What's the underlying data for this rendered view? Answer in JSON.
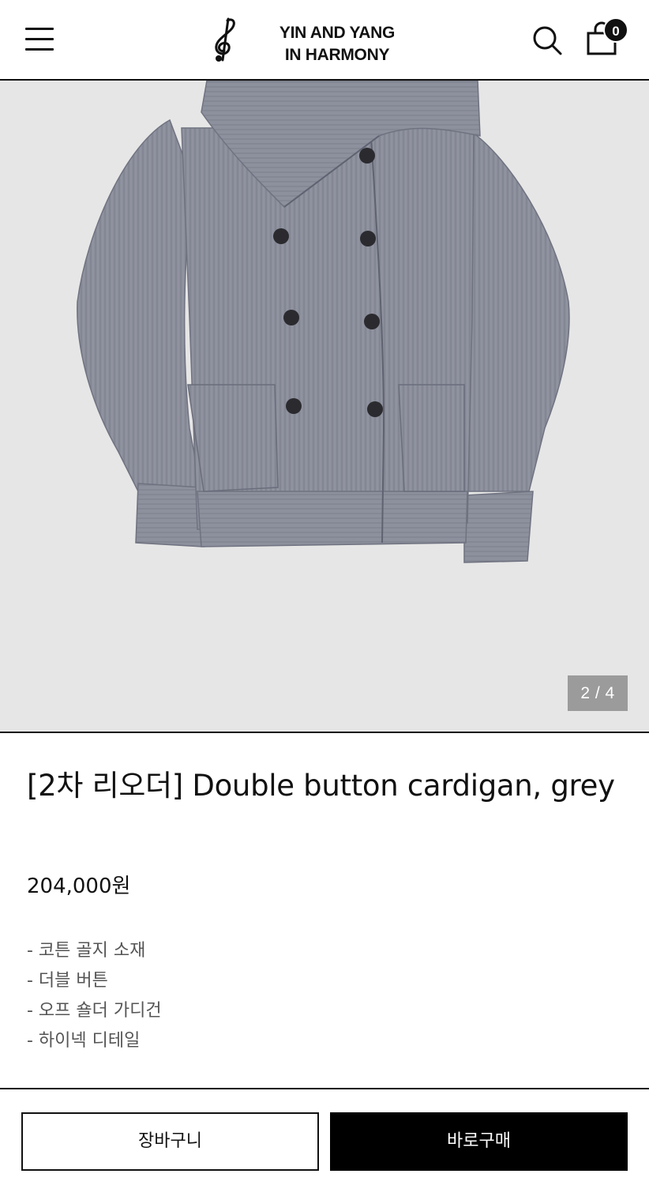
{
  "header": {
    "menu_icon": "hamburger-menu-icon",
    "logo_icon": "treble-clef-icon",
    "logo_line1": "YIN AND YANG",
    "logo_line2": "IN HARMONY",
    "search_icon": "search-icon",
    "cart_icon": "shopping-bag-icon",
    "cart_count": "0"
  },
  "gallery": {
    "image_description_icon": "product-photo",
    "page_indicator": "2 / 4",
    "background_color": "#e6e6e6"
  },
  "product": {
    "title": "[2차 리오더] Double button cardigan, grey",
    "price": "204,000원",
    "details": [
      "- 코튼 골지 소재",
      "- 더블 버튼",
      "- 오프 숄더 가디건",
      "- 하이넥 디테일"
    ]
  },
  "actions": {
    "add_to_cart": "장바구니",
    "buy_now": "바로구매"
  },
  "colors": {
    "accent": "#000000",
    "indicator": "#9b9b9b",
    "garment": "#8a8d9a"
  }
}
